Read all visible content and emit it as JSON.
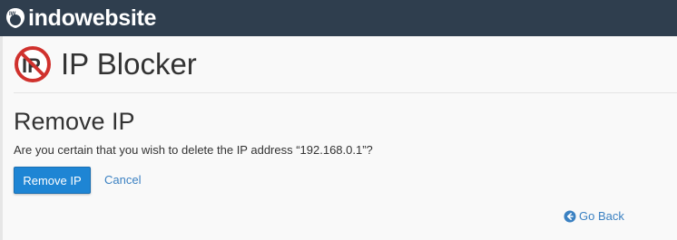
{
  "header": {
    "brand_name": "indowebsite",
    "brand_badge": "IW"
  },
  "page": {
    "icon": "ip-blocker-icon",
    "icon_letters": "IP",
    "title": "IP Blocker"
  },
  "section": {
    "title": "Remove IP",
    "confirm_text": "Are you certain that you wish to delete the IP address “192.168.0.1”?"
  },
  "actions": {
    "remove_label": "Remove IP",
    "cancel_label": "Cancel"
  },
  "footer": {
    "go_back_label": "Go Back"
  },
  "colors": {
    "topbar": "#2f3e4e",
    "primary": "#1e85d4",
    "link": "#3b81c2",
    "no_sign": "#d0312d"
  }
}
